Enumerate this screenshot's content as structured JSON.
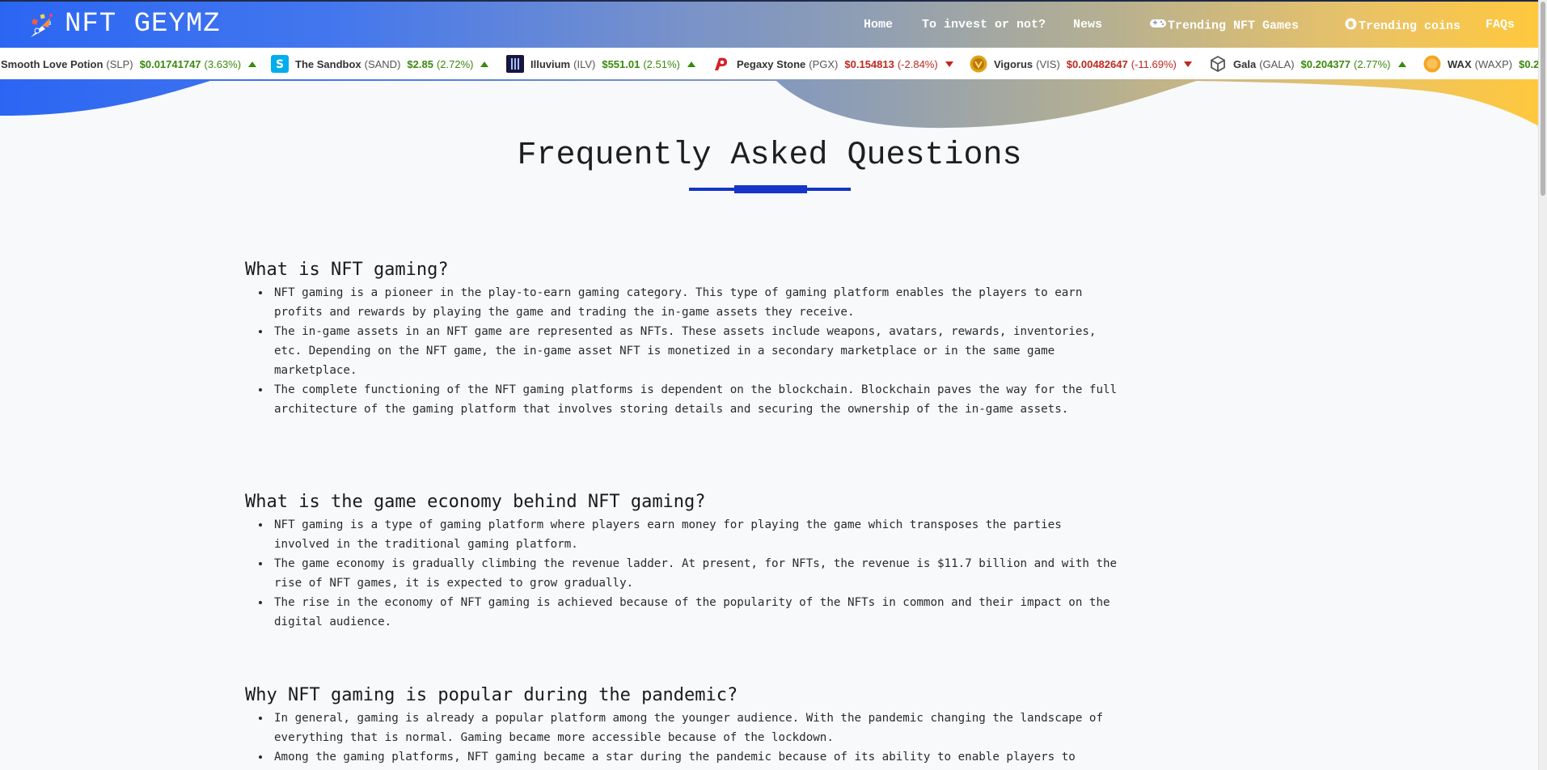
{
  "brand": {
    "name": "NFT GEYMZ"
  },
  "nav": {
    "items": [
      {
        "label": "Home"
      },
      {
        "label": "To invest or not?"
      },
      {
        "label": "News"
      },
      {
        "label": "Trending NFT Games",
        "icon": "gamepad-icon"
      },
      {
        "label": "Trending coins",
        "icon": "bitcoin-icon"
      },
      {
        "label": "FAQs"
      }
    ]
  },
  "ticker": [
    {
      "name": "Smooth Love Potion",
      "symbol": "(SLP)",
      "price": "$0.01741747",
      "change": "(3.63%)",
      "direction": "up"
    },
    {
      "name": "The Sandbox",
      "symbol": "(SAND)",
      "price": "$2.85",
      "change": "(2.72%)",
      "direction": "up",
      "logo_color": "#00adef"
    },
    {
      "name": "Illuvium",
      "symbol": "(ILV)",
      "price": "$551.01",
      "change": "(2.51%)",
      "direction": "up",
      "logo_color": "#1b1440"
    },
    {
      "name": "Pegaxy Stone",
      "symbol": "(PGX)",
      "price": "$0.154813",
      "change": "(-2.84%)",
      "direction": "down",
      "logo_color": "#d61f26"
    },
    {
      "name": "Vigorus",
      "symbol": "(VIS)",
      "price": "$0.00482647",
      "change": "(-11.69%)",
      "direction": "down",
      "logo_color": "#e0a21a"
    },
    {
      "name": "Gala",
      "symbol": "(GALA)",
      "price": "$0.204377",
      "change": "(2.77%)",
      "direction": "up",
      "logo_color": "#555555"
    },
    {
      "name": "WAX",
      "symbol": "(WAXP)",
      "price": "$0.2",
      "change": "",
      "direction": "up",
      "logo_color": "#f5a623"
    }
  ],
  "page": {
    "title": "Frequently Asked Questions"
  },
  "faqs": [
    {
      "question": "What is NFT gaming?",
      "answers": [
        "NFT gaming is a pioneer in the play-to-earn gaming category. This type of gaming platform enables the players to earn profits and rewards by playing the game and trading the in-game assets they receive.",
        "The in-game assets in an NFT game are represented as NFTs. These assets include weapons, avatars, rewards, inventories, etc. Depending on the NFT game, the in-game asset NFT is monetized in a secondary marketplace or in the same game marketplace.",
        "The complete functioning of the NFT gaming platforms is dependent on the blockchain. Blockchain paves the way for the full architecture of the gaming platform that involves storing details and securing the ownership of the in-game assets."
      ]
    },
    {
      "question": "What is the game economy behind NFT gaming?",
      "answers": [
        "NFT gaming is a type of gaming platform where players earn money for playing the game which transposes the parties involved in the traditional gaming platform.",
        "The game economy is gradually climbing the revenue ladder. At present, for NFTs, the revenue is $11.7 billion and with the rise of NFT games, it is expected to grow gradually.",
        "The rise in the economy of NFT gaming is achieved because of the popularity of the NFTs in common and their impact on the digital audience."
      ]
    },
    {
      "question": "Why NFT gaming is popular during the pandemic?",
      "answers": [
        "In general, gaming is already a popular platform among the younger audience. With the pandemic changing the landscape of everything that is normal. Gaming became more accessible because of the lockdown.",
        "Among the gaming platforms, NFT gaming became a star during the pandemic because of its ability to enable players to"
      ]
    }
  ]
}
